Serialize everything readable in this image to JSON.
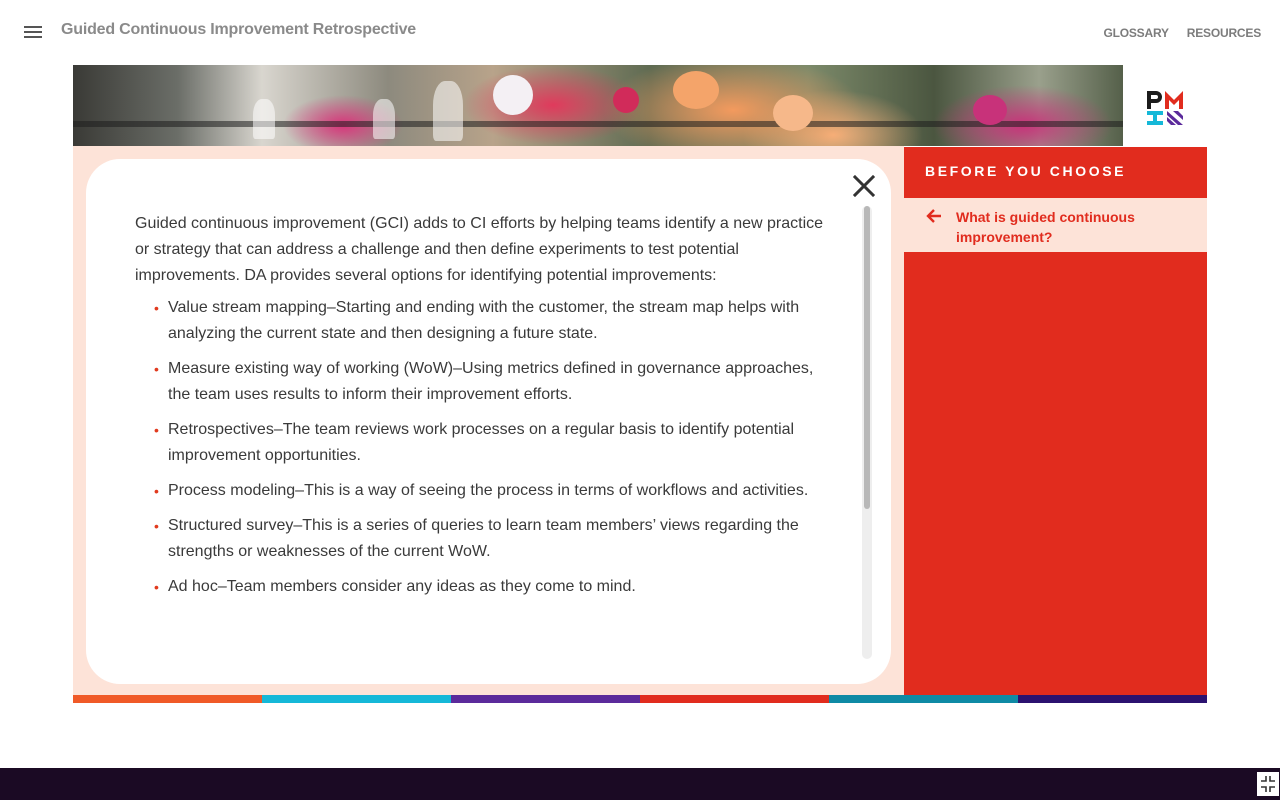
{
  "header": {
    "course_title": "Guided Continuous Improvement Retrospective",
    "nav": [
      {
        "label": "GLOSSARY"
      },
      {
        "label": "RESOURCES"
      }
    ]
  },
  "content": {
    "intro": "Guided continuous improvement (GCI) adds to CI efforts by helping teams identify a new practice or strategy that can address a challenge and then define experiments to test potential improvements. DA provides several options for identifying potential improvements:",
    "bullet_glyph": "•",
    "items": [
      "Value stream mapping–Starting and ending with the customer, the stream map helps with analyzing the current state and then designing a future state.",
      "Measure existing way of working (WoW)–Using metrics defined in governance approaches, the team uses results to inform their improvement efforts.",
      "Retrospectives–The team reviews work processes on a regular basis to identify potential improvement opportunities.",
      "Process modeling–This is a way of seeing the process in terms of workflows and activities.",
      "Structured survey–This is a series of queries to learn team members’ views regarding the strengths or weaknesses of the current WoW.",
      "Ad hoc–Team members consider any ideas as they come to mind."
    ]
  },
  "sidebar": {
    "heading": "BEFORE YOU CHOOSE",
    "item_label": "What is guided continuous improvement?"
  },
  "icons": {
    "menu": "hamburger-menu-icon",
    "close": "close-icon",
    "back": "arrow-left-icon",
    "logo": "pmi-logo",
    "fullscreen": "exit-fullscreen-icon"
  },
  "colors": {
    "accent": "#e12c1e",
    "panel_tint": "#fde3d8",
    "footer": "#1b0a24",
    "strip": [
      "#f05a28",
      "#15b8d8",
      "#5b2a9b",
      "#e12c1e",
      "#0f8aa5",
      "#2b1270"
    ]
  }
}
